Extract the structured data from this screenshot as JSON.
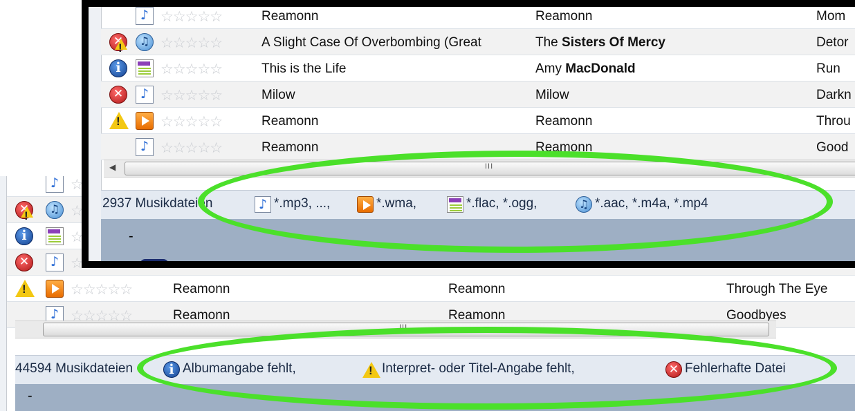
{
  "bottom_panel": {
    "rows": [
      {
        "status_icon": "none",
        "type_icon": "mp3-note-icon",
        "col1": "",
        "col2": "",
        "col3": ""
      },
      {
        "status_icon": "error-warning-icon",
        "type_icon": "aac-disc-icon",
        "col1": "",
        "col2": "",
        "col3": ""
      },
      {
        "status_icon": "info-icon",
        "type_icon": "flac-file-icon",
        "col1": "",
        "col2": "",
        "col3": ""
      },
      {
        "status_icon": "error-icon",
        "type_icon": "mp3-note-icon",
        "col1": "Milow",
        "col2": "Milow",
        "col3": "Darkness Ahead /"
      },
      {
        "status_icon": "warning-icon",
        "type_icon": "wma-play-icon",
        "col1": "Reamonn",
        "col2": "Reamonn",
        "col3": "Through The Eye"
      },
      {
        "status_icon": "none",
        "type_icon": "mp3-note-icon",
        "col1": "Reamonn",
        "col2": "Reamonn",
        "col3": "Goodbyes"
      }
    ],
    "scroll_grip": "III",
    "status": {
      "count": "44594 Musikdateien",
      "items": [
        {
          "icon": "info-icon",
          "label": "Albumangabe fehlt,"
        },
        {
          "icon": "warning-icon",
          "label": "Interpret- oder Titel-Angabe fehlt,"
        },
        {
          "icon": "error-icon",
          "label": "Fehlerhafte Datei"
        }
      ]
    },
    "footer_text": "-"
  },
  "top_panel": {
    "rows": [
      {
        "status_icon": "none",
        "type_icon": "mp3-note-icon",
        "col1": "Reamonn",
        "col2_pre": "Reamonn",
        "col2_bold": "",
        "col3": "Mom"
      },
      {
        "status_icon": "error-warning-icon",
        "type_icon": "aac-disc-icon",
        "col1": "A Slight Case Of Overbombing (Great",
        "col2_pre": "The ",
        "col2_bold": "Sisters Of Mercy",
        "col3": "Detor"
      },
      {
        "status_icon": "info-icon",
        "type_icon": "flac-file-icon",
        "col1": "This is the Life",
        "col2_pre": "Amy ",
        "col2_bold": "MacDonald",
        "col3": "Run"
      },
      {
        "status_icon": "error-icon",
        "type_icon": "mp3-note-icon",
        "col1": "Milow",
        "col2_pre": "Milow",
        "col2_bold": "",
        "col3": "Darkn"
      },
      {
        "status_icon": "warning-icon",
        "type_icon": "wma-play-icon",
        "col1": "Reamonn",
        "col2_pre": "Reamonn",
        "col2_bold": "",
        "col3": "Throu"
      },
      {
        "status_icon": "none",
        "type_icon": "mp3-note-icon",
        "col1": "Reamonn",
        "col2_pre": "Reamonn",
        "col2_bold": "",
        "col3": "Good"
      }
    ],
    "scroll_left_arrow": "◀",
    "scroll_grip": "III",
    "status": {
      "count": "2937 Musikdateien",
      "items": [
        {
          "icon": "mp3-note-icon",
          "label": "*.mp3, ...,"
        },
        {
          "icon": "wma-play-icon",
          "label": "*.wma,"
        },
        {
          "icon": "flac-file-icon",
          "label": "*.flac, *.ogg,"
        },
        {
          "icon": "aac-disc-icon",
          "label": "*.aac, *.m4a, *.mp4"
        }
      ]
    },
    "footer_text": "-"
  },
  "rating_stars": "☆☆☆☆☆",
  "annotation_colors": {
    "highlight_ellipse": "#4be02a",
    "cursor_arrow": "#e01e1e",
    "frame": "#000000"
  }
}
